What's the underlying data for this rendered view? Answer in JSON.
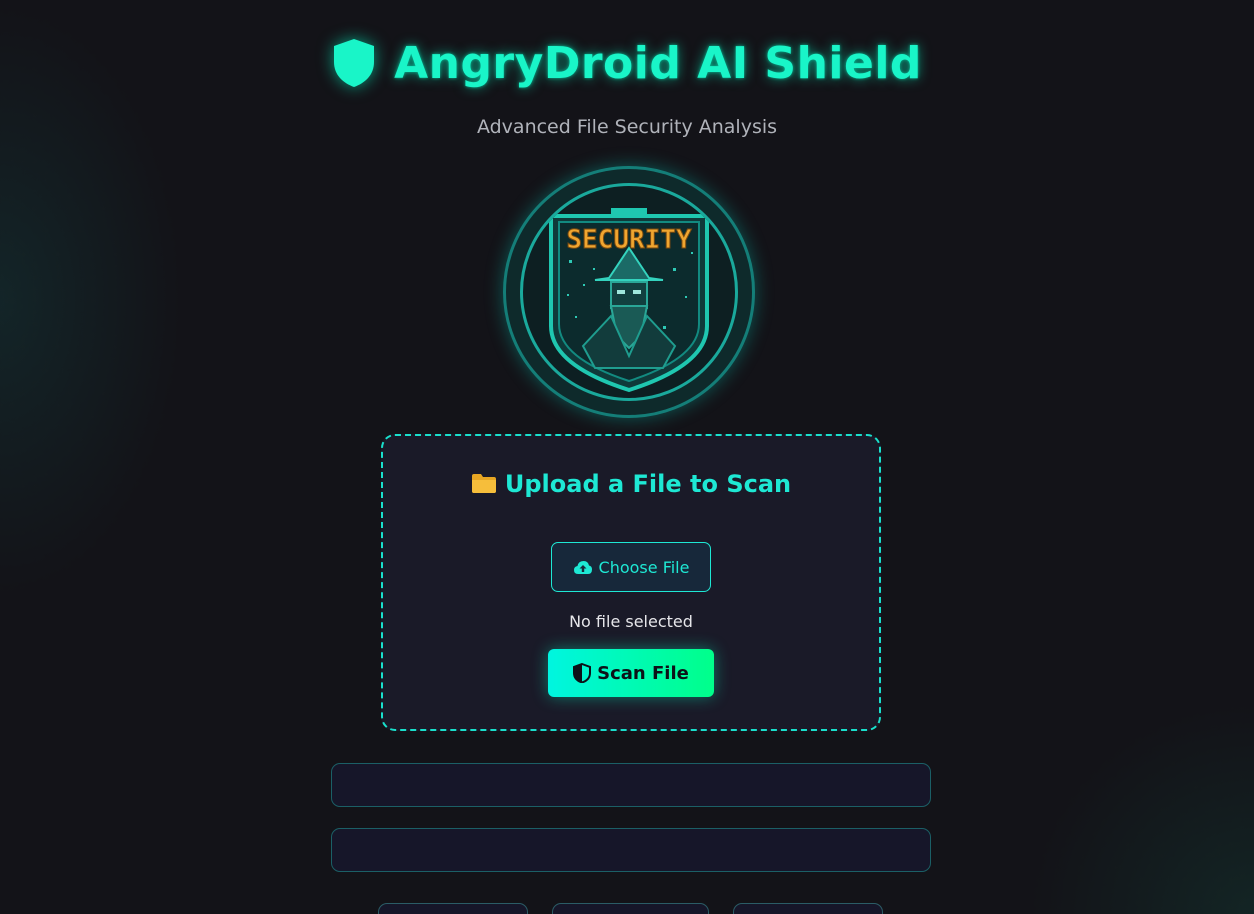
{
  "header": {
    "title": "AngryDroid AI Shield",
    "subtitle": "Advanced File Security Analysis",
    "title_icon": "shield-icon"
  },
  "logo": {
    "text": "SECURITY",
    "image": "pixel-art hooded wizard on shield badge"
  },
  "upload": {
    "title": "Upload a File to Scan",
    "title_icon": "folder-icon",
    "choose_label": "Choose File",
    "choose_icon": "cloud-upload-icon",
    "status": "No file selected",
    "scan_label": "Scan File",
    "scan_icon": "shield-half-icon"
  },
  "colors": {
    "accent": "#19f5c8",
    "background": "#131318",
    "panel": "#1a1a28",
    "scan_gradient_start": "#00f5e0",
    "scan_gradient_end": "#00ff8a",
    "logo_text": "#f0a630"
  }
}
